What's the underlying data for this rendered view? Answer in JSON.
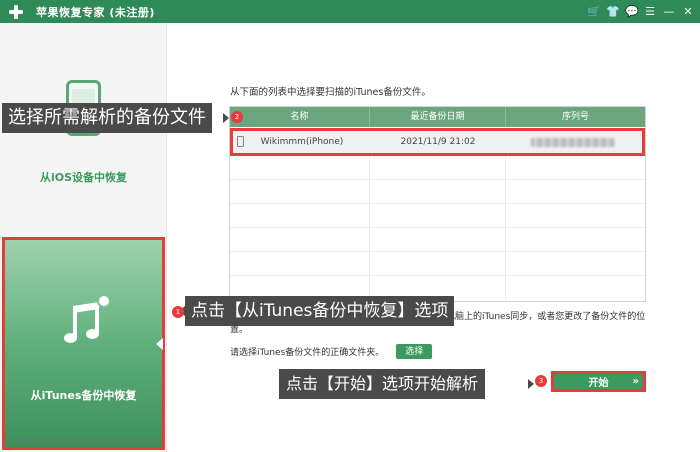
{
  "titlebar": {
    "title": "苹果恢复专家 (未注册)",
    "icons": [
      "cart-icon",
      "skin-icon",
      "feedback-icon",
      "menu-icon",
      "minimize-icon",
      "close-icon"
    ],
    "icon_glyphs": [
      "🛒",
      "👕",
      "💬",
      "☰",
      "—",
      "✕"
    ]
  },
  "sidebar": {
    "items": [
      {
        "label": "从iOS设备中恢复",
        "icon": "phone-icon",
        "selected": false
      },
      {
        "label": "从iTunes备份中恢复",
        "icon": "music-refresh-icon",
        "selected": true
      }
    ]
  },
  "main": {
    "instruction": "从下面的列表中选择要扫描的iTunes备份文件。",
    "table": {
      "columns": [
        "名称",
        "最近备份日期",
        "序列号"
      ],
      "rows": [
        {
          "name": "Wikimmm(iPhone)",
          "date": "2021/11/9 21:02",
          "serial": ""
        }
      ]
    },
    "note": "如果您的备份文件不在列表中，可能您的设备没有与本电脑上的iTunes同步，或者您更改了备份文件的位置。",
    "choose_folder_text": "请选择iTunes备份文件的正确文件夹。",
    "choose_button": "选择",
    "start_button": "开始",
    "start_arrows": "»"
  },
  "annotations": [
    {
      "number": "2",
      "text": "选择所需解析的备份文件"
    },
    {
      "number": "1",
      "text": "点击【从iTunes备份中恢复】选项"
    },
    {
      "number": "3",
      "text": "点击【开始】选项开始解析"
    }
  ],
  "colors": {
    "brand_green": "#2e8b57",
    "table_header": "#6ca67f",
    "button_green": "#3d9a5e",
    "highlight_red": "#e83b3b",
    "callout_bg": "#4a4a4a"
  }
}
